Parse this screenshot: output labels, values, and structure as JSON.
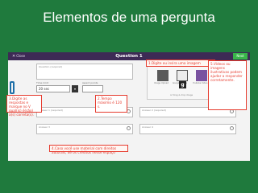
{
  "slide": {
    "title": "Elementos de uma pergunta"
  },
  "app": {
    "close_label": "Close",
    "question_title": "Question 1",
    "next_label": "Next"
  },
  "question_field": {
    "label": "Question",
    "hint": "(required)"
  },
  "time_limit": {
    "label": "Time limit",
    "value": "20 sec"
  },
  "points": {
    "label": "Award points"
  },
  "media": {
    "items": [
      "Image Upload",
      "Google Image",
      "Youtube Video"
    ],
    "drag_text": "or Drag & drop image"
  },
  "answers": [
    {
      "label": "Answer 1",
      "hint": "(required)"
    },
    {
      "label": "Answer 2",
      "hint": "(required)"
    },
    {
      "label": "Answer 3",
      "hint": ""
    },
    {
      "label": "Answer 4",
      "hint": ""
    }
  ],
  "annotations": {
    "a1": "1.Digite ou insira uma imagem",
    "a2": "5.Vídeos ou imagens ilustrativas podem ajudar a responder corretamente.",
    "a3": "3.Digite as respostas e marque no V qual(is) é(são) a(s) correta(s).",
    "a4": "2.Tempo máximo é 120 s.",
    "a5": "4.Caso você use material com direitos autorais, dê os créditos nesse espaço"
  },
  "colors": {
    "background": "#1f7a3d",
    "topbar": "#3d2a55",
    "next": "#39b54a",
    "annotation": "#e63b2e",
    "tick": "#1e6fa8"
  }
}
